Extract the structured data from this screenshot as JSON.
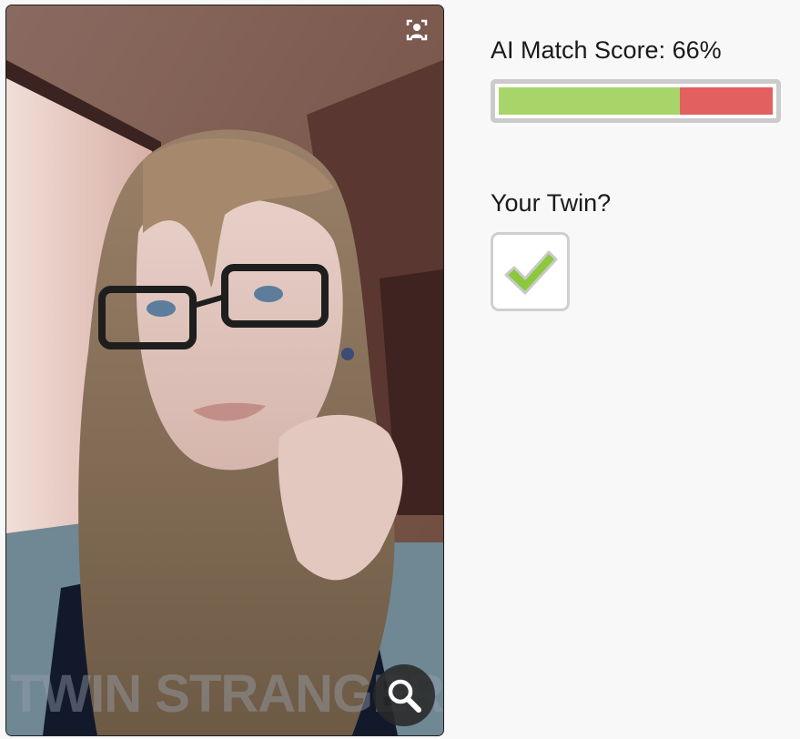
{
  "photo": {
    "subject": "user-photo",
    "watermark_text": "TWIN STRANGERS"
  },
  "icons": {
    "face_detect": "face-detect-icon",
    "zoom": "magnifier-icon",
    "check": "checkmark-icon"
  },
  "match": {
    "label": "AI Match Score: 66%",
    "score_fraction": 0.66,
    "colors": {
      "fill": "#a8d56a",
      "remainder": "#e36060",
      "frame": "#cbcbcb"
    }
  },
  "twin": {
    "label": "Your Twin?",
    "checked": true,
    "check_color": "#8bc83b"
  }
}
